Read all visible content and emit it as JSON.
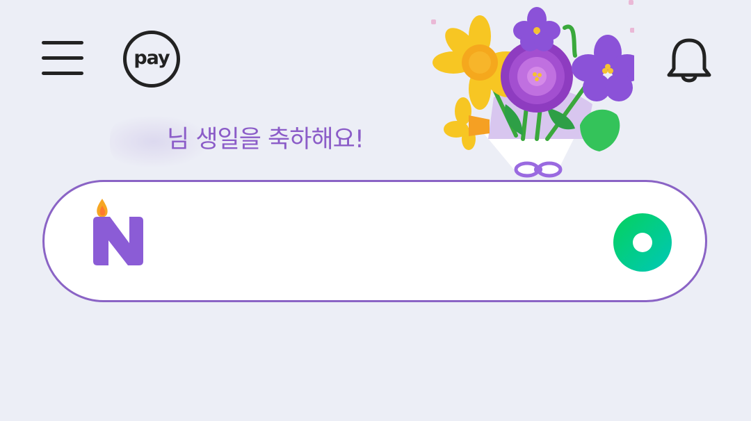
{
  "header": {
    "menu_icon": "hamburger-menu-icon",
    "pay_label": "pay",
    "bell_icon": "bell-icon"
  },
  "banner": {
    "greeting_suffix": "님 생일을 축하해요!",
    "illustration": "flower-bouquet",
    "colors": {
      "greeting": "#8b5cc8"
    }
  },
  "search": {
    "logo": "N",
    "logo_icon": "birthday-candle-n-logo-icon",
    "action_icon": "green-circle-icon",
    "placeholder": "",
    "colors": {
      "border": "#8a63c5",
      "logo": "#8b5cd6",
      "action": "#03c75a"
    }
  }
}
